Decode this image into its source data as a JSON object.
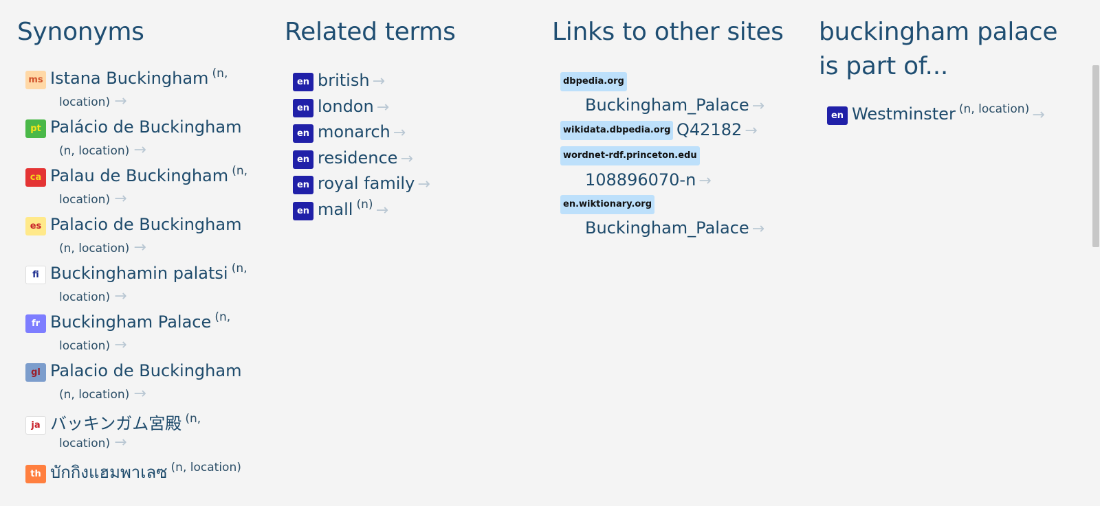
{
  "synonyms": {
    "heading": "Synonyms",
    "items": [
      {
        "lang": "ms",
        "term": "Istana Buckingham",
        "meta_a": "(n,",
        "meta_b": "location)",
        "arrow": "→",
        "badge_bg": "#ffd8a6",
        "badge_fg": "#d1542c"
      },
      {
        "lang": "pt",
        "term": "Palácio de Buckingham",
        "meta_a": "",
        "meta_b": "(n, location)",
        "arrow": "→",
        "badge_bg": "#4ab848",
        "badge_fg": "#f4e41a"
      },
      {
        "lang": "ca",
        "term": "Palau de Buckingham",
        "meta_a": "(n,",
        "meta_b": "location)",
        "arrow": "→",
        "badge_bg": "#e43434",
        "badge_fg": "#f5d61c"
      },
      {
        "lang": "es",
        "term": "Palacio de Buckingham",
        "meta_a": "",
        "meta_b": "(n, location)",
        "arrow": "→",
        "badge_bg": "#ffe98a",
        "badge_fg": "#c8222a"
      },
      {
        "lang": "fi",
        "term": "Buckinghamin palatsi",
        "meta_a": "(n,",
        "meta_b": "location)",
        "arrow": "→",
        "badge_bg": "#ffffff",
        "badge_fg": "#1b2c8f"
      },
      {
        "lang": "fr",
        "term": "Buckingham Palace",
        "meta_a": "(n,",
        "meta_b": "location)",
        "arrow": "→",
        "badge_bg": "#7d7dff",
        "badge_fg": "#ffffff"
      },
      {
        "lang": "gl",
        "term": "Palacio de Buckingham",
        "meta_a": "",
        "meta_b": "(n, location)",
        "arrow": "→",
        "badge_bg": "#7c9dcc",
        "badge_fg": "#9b1e2a"
      },
      {
        "lang": "ja",
        "term": "バッキンガム宮殿",
        "meta_a": "(n,",
        "meta_b": "location)",
        "arrow": "→",
        "badge_bg": "#ffffff",
        "badge_fg": "#c8222a"
      },
      {
        "lang": "th",
        "term": "บักกิงแฮมพาเลซ",
        "meta_a": "(n, location)",
        "meta_b": "",
        "arrow": "",
        "badge_bg": "#ff7f3f",
        "badge_fg": "#ffffff"
      }
    ]
  },
  "related": {
    "heading": "Related terms",
    "items": [
      {
        "lang": "en",
        "term": "british",
        "meta": "",
        "arrow": "→"
      },
      {
        "lang": "en",
        "term": "london",
        "meta": "",
        "arrow": "→"
      },
      {
        "lang": "en",
        "term": "monarch",
        "meta": "",
        "arrow": "→"
      },
      {
        "lang": "en",
        "term": "residence",
        "meta": "",
        "arrow": "→"
      },
      {
        "lang": "en",
        "term": "royal family",
        "meta": "",
        "arrow": "→"
      },
      {
        "lang": "en",
        "term": "mall",
        "meta": "(n)",
        "arrow": "→"
      }
    ]
  },
  "links": {
    "heading": "Links to other sites",
    "items": [
      {
        "site": "dbpedia.org",
        "value": "Buckingham_Palace",
        "arrow": "→"
      },
      {
        "site": "wikidata.dbpedia.org",
        "value": "Q42182",
        "arrow": "→"
      },
      {
        "site": "wordnet-rdf.princeton.edu",
        "value": "108896070-n",
        "arrow": "→"
      },
      {
        "site": "en.wiktionary.org",
        "value": "Buckingham_Palace",
        "arrow": "→"
      }
    ]
  },
  "part_of": {
    "heading_line1": "buckingham palace",
    "heading_line2": "is part of...",
    "items": [
      {
        "lang": "en",
        "term": "Westminster",
        "meta": "(n, location)",
        "arrow": "→"
      }
    ]
  },
  "colors": {
    "en_badge_bg": "#2020a8",
    "en_badge_fg": "#ffffff",
    "site_bg": "#bde0fb",
    "heading": "#1f4e72",
    "arrow": "#b9c7d3"
  }
}
